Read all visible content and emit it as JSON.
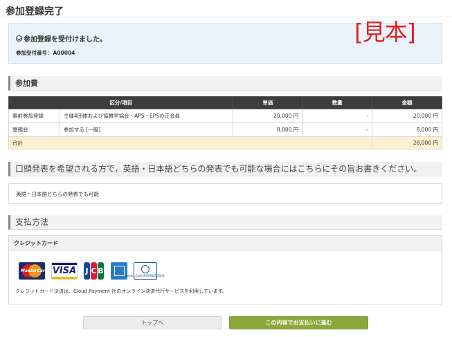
{
  "page": {
    "title": "参加登録完了"
  },
  "notice": {
    "message": "参加登録を受付けました。",
    "number_label": "参加受付番号：",
    "number_value": "A00004",
    "stamp": "[見本]"
  },
  "fee_section": {
    "title": "参加費",
    "columns": [
      "区分/項目",
      "単価",
      "数量",
      "金額"
    ],
    "rows": [
      {
        "category": "事前参加登録",
        "item": "主催4団体および協賛学協会・APS・EPSの正会員",
        "unit_price": "20,000 円",
        "quantity": "-",
        "amount": "20,000 円"
      },
      {
        "category": "懇親会",
        "item": "参加する [一般]",
        "unit_price": "8,000 円",
        "quantity": "-",
        "amount": "8,000 円"
      }
    ],
    "total": {
      "label": "合計",
      "amount": "28,000 円"
    }
  },
  "oral_section": {
    "title": "口頭発表を希望される方で，英語・日本語どちらの発表でも可能な場合にはこちらにその旨お書きください。",
    "value": "英語・日本語どちらの発表でも可能"
  },
  "payment_section": {
    "title": "支払方法",
    "method": "クレジットカード",
    "cards": [
      {
        "icon": "mastercard-icon",
        "text": "MasterCard"
      },
      {
        "icon": "visa-icon",
        "text": "VISA"
      },
      {
        "icon": "jcb-icon",
        "text": "JCB"
      },
      {
        "icon": "amex-icon",
        "text": ""
      },
      {
        "icon": "diners-icon",
        "text": "Diners Club INTERNATIONAL"
      }
    ],
    "note": "クレジットカード決済は、Cloud Payment 社のオンライン決済代行サービスを利用しています。"
  },
  "buttons": {
    "top": "トップへ",
    "pay": "この内容でお支払いに進む"
  },
  "colors": {
    "header_dark": "#3d3d3d",
    "total_bg": "#fdf0cf",
    "pay_button": "#8aa838",
    "stamp": "#e02020"
  }
}
